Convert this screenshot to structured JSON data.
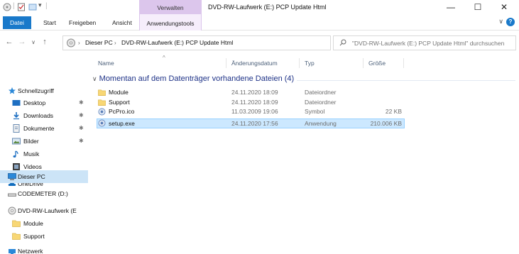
{
  "window": {
    "title": "DVD-RW-Laufwerk (E:) PCP Update Html",
    "context_tab_group": "Verwalten",
    "controls": {
      "minimize": "—",
      "maximize": "☐",
      "close": "✕"
    }
  },
  "ribbon": {
    "tabs": [
      "Datei",
      "Start",
      "Freigeben",
      "Ansicht",
      "Anwendungstools"
    ],
    "active_tab_color": "#1979ca",
    "context_color": "#dcc6ec"
  },
  "address": {
    "crumbs": [
      "Dieser PC",
      "DVD-RW-Laufwerk (E:) PCP Update Html"
    ],
    "search_placeholder": "\"DVD-RW-Laufwerk (E:) PCP Update Html\" durchsuchen"
  },
  "nav": {
    "items": [
      {
        "label": "Schnellzugriff",
        "icon": "star-icon"
      },
      {
        "label": "Desktop",
        "icon": "desktop-icon",
        "pinned": true
      },
      {
        "label": "Downloads",
        "icon": "download-icon",
        "pinned": true
      },
      {
        "label": "Dokumente",
        "icon": "document-icon",
        "pinned": true
      },
      {
        "label": "Bilder",
        "icon": "pictures-icon",
        "pinned": true
      },
      {
        "label": "Musik",
        "icon": "music-icon"
      },
      {
        "label": "Videos",
        "icon": "video-icon"
      },
      {
        "label": "OneDrive",
        "icon": "cloud-icon"
      },
      {
        "label": "Dieser PC",
        "icon": "computer-icon",
        "selected": true
      },
      {
        "label": "CODEMETER (D:)",
        "icon": "drive-icon"
      },
      {
        "label": "DVD-RW-Laufwerk (E",
        "icon": "dvd-drive-icon"
      },
      {
        "label": "Module",
        "icon": "folder-icon"
      },
      {
        "label": "Support",
        "icon": "folder-icon"
      },
      {
        "label": "Netzwerk",
        "icon": "network-icon"
      }
    ],
    "pin_glyph": "✱"
  },
  "content": {
    "columns": [
      "Name",
      "Änderungsdatum",
      "Typ",
      "Größe"
    ],
    "group_title": "Momentan auf dem Datenträger vorhandene Dateien (4)",
    "rows": [
      {
        "name": "Module",
        "date": "24.11.2020 18:09",
        "type": "Dateiordner",
        "size": "",
        "icon": "folder-icon"
      },
      {
        "name": "Support",
        "date": "24.11.2020 18:09",
        "type": "Dateiordner",
        "size": "",
        "icon": "folder-icon"
      },
      {
        "name": "PcPro.ico",
        "date": "11.03.2009 19:06",
        "type": "Symbol",
        "size": "22 KB",
        "icon": "ico-file-icon"
      },
      {
        "name": "setup.exe",
        "date": "24.11.2020 17:56",
        "type": "Anwendung",
        "size": "210.006 KB",
        "icon": "exe-file-icon",
        "selected": true
      }
    ],
    "selection_color": "#cce8ff"
  }
}
